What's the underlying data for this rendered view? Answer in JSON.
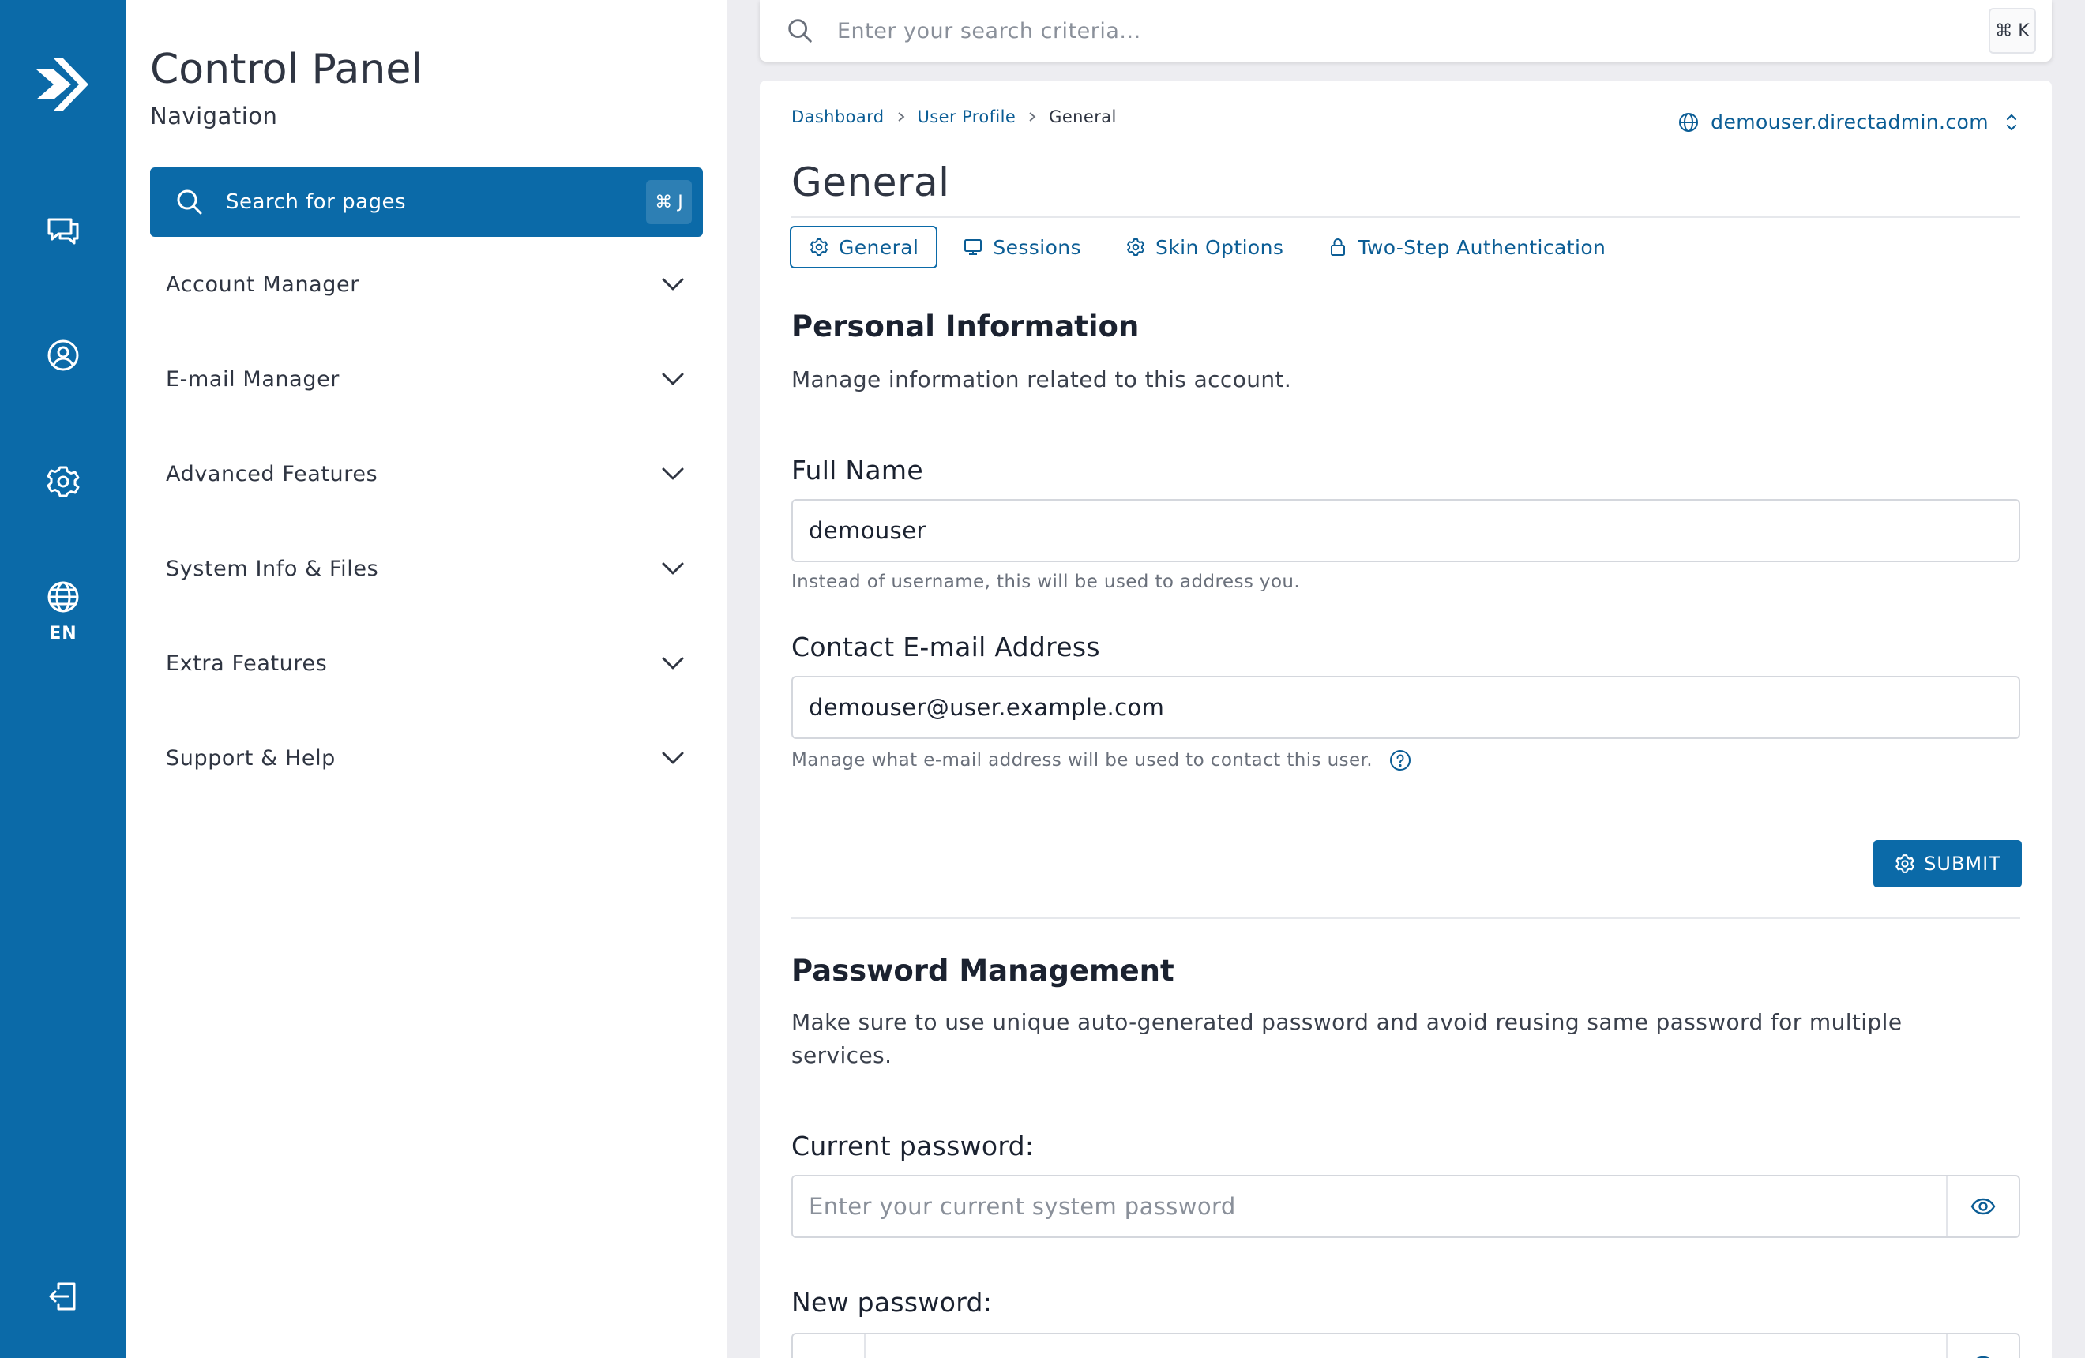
{
  "rail": {
    "language": "EN",
    "colors": {
      "background": "#0b6aa8",
      "icon": "#ffffff"
    },
    "icons": [
      "directadmin-logo-icon",
      "chat-icon",
      "user-circle-icon",
      "gear-icon",
      "globe-icon",
      "logout-icon"
    ]
  },
  "nav": {
    "title": "Control Panel",
    "subtitle": "Navigation",
    "search_label": "Search for pages",
    "search_shortcut": "⌘ J",
    "items": [
      {
        "label": "Account Manager"
      },
      {
        "label": "E-mail Manager"
      },
      {
        "label": "Advanced Features"
      },
      {
        "label": "System Info & Files"
      },
      {
        "label": "Extra Features"
      },
      {
        "label": "Support & Help"
      }
    ]
  },
  "topbar": {
    "placeholder": "Enter your search criteria...",
    "shortcut": "⌘ K"
  },
  "breadcrumb": {
    "items": [
      "Dashboard",
      "User Profile"
    ],
    "current": "General"
  },
  "domain": "demouser.directadmin.com",
  "page_title": "General",
  "tabs": [
    {
      "label": "General",
      "icon": "gear-icon",
      "active": true
    },
    {
      "label": "Sessions",
      "icon": "monitor-icon",
      "active": false
    },
    {
      "label": "Skin Options",
      "icon": "gear-icon",
      "active": false
    },
    {
      "label": "Two-Step Authentication",
      "icon": "lock-icon",
      "active": false
    }
  ],
  "personal": {
    "heading": "Personal Information",
    "description": "Manage information related to this account.",
    "full_name": {
      "label": "Full Name",
      "value": "demouser",
      "helper": "Instead of username, this will be used to address you."
    },
    "email": {
      "label": "Contact E-mail Address",
      "value": "demouser@user.example.com",
      "helper": "Manage what e-mail address will be used to contact this user."
    },
    "submit_label": "SUBMIT"
  },
  "password": {
    "heading": "Password Management",
    "description": "Make sure to use unique auto-generated password and avoid reusing same password for multiple services.",
    "current": {
      "label": "Current password:",
      "placeholder": "Enter your current system password"
    },
    "new": {
      "label": "New password:"
    }
  },
  "colors": {
    "accent": "#0b6aa8",
    "link": "#0b5d95",
    "background": "#ededf1"
  }
}
